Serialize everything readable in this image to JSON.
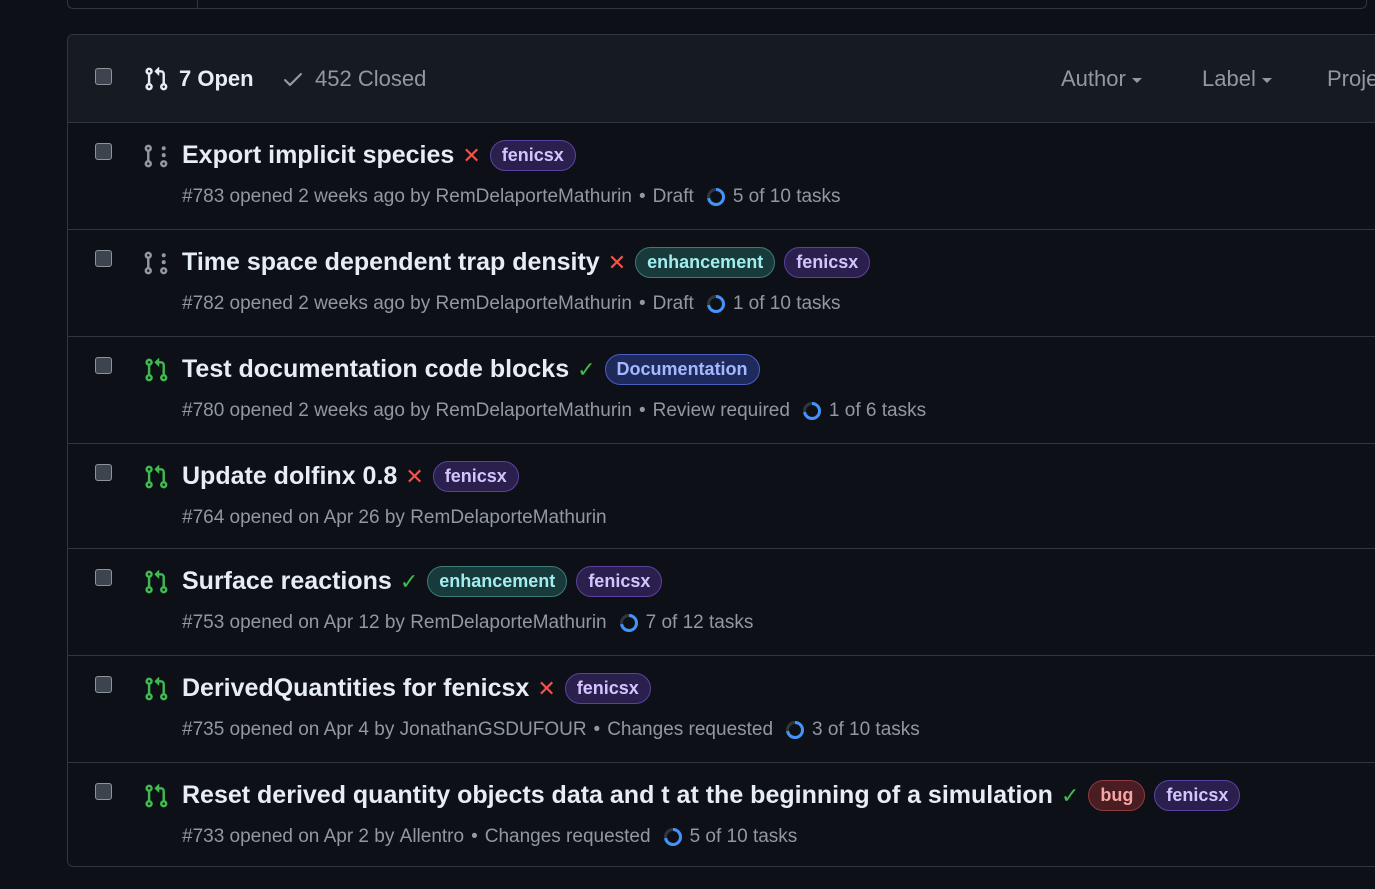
{
  "header": {
    "open_count_label": "7 Open",
    "closed_count_label": "452 Closed",
    "filters": [
      "Author",
      "Label",
      "Proje"
    ]
  },
  "colors": {
    "open_icon": "#3fb950",
    "draft_icon": "#9198a1",
    "check_fail": "#f85149",
    "check_ok": "#3fb950",
    "progress": "#4493f8"
  },
  "labels": {
    "fenicsx": {
      "text": "fenicsx",
      "bg": "#2b1f4d",
      "fg": "#d3c4ff",
      "border": "#5a43a0"
    },
    "enhancement": {
      "text": "enhancement",
      "bg": "#193a3a",
      "fg": "#a2eeef",
      "border": "#3d7a78"
    },
    "documentation": {
      "text": "Documentation",
      "bg": "#1f2a5c",
      "fg": "#a5b8ff",
      "border": "#4a5fbf"
    },
    "bug": {
      "text": "bug",
      "bg": "#4a1d22",
      "fg": "#f6a4a4",
      "border": "#8e3a40"
    }
  },
  "pull_requests": [
    {
      "state": "draft",
      "title": "Export implicit species",
      "check": "fail",
      "labels": [
        "fenicsx"
      ],
      "number_opened": "#783 opened 2 weeks ago by",
      "author": "RemDelaporteMathurin",
      "review": "Draft",
      "tasks": "5 of 10 tasks",
      "tasks_done": 5,
      "tasks_total": 10
    },
    {
      "state": "draft",
      "title": "Time space dependent trap density",
      "check": "fail",
      "labels": [
        "enhancement",
        "fenicsx"
      ],
      "number_opened": "#782 opened 2 weeks ago by",
      "author": "RemDelaporteMathurin",
      "review": "Draft",
      "tasks": "1 of 10 tasks",
      "tasks_done": 1,
      "tasks_total": 10
    },
    {
      "state": "open",
      "title": "Test documentation code blocks",
      "check": "ok",
      "labels": [
        "documentation"
      ],
      "number_opened": "#780 opened 2 weeks ago by",
      "author": "RemDelaporteMathurin",
      "review": "Review required",
      "tasks": "1 of 6 tasks",
      "tasks_done": 1,
      "tasks_total": 6
    },
    {
      "state": "open",
      "title": "Update dolfinx 0.8",
      "check": "fail",
      "labels": [
        "fenicsx"
      ],
      "number_opened": "#764 opened on Apr 26 by",
      "author": "RemDelaporteMathurin",
      "review": "",
      "tasks": "",
      "tasks_done": 0,
      "tasks_total": 0
    },
    {
      "state": "open",
      "title": "Surface reactions",
      "check": "ok",
      "labels": [
        "enhancement",
        "fenicsx"
      ],
      "number_opened": "#753 opened on Apr 12 by",
      "author": "RemDelaporteMathurin",
      "review": "",
      "tasks": "7 of 12 tasks",
      "tasks_done": 7,
      "tasks_total": 12
    },
    {
      "state": "open",
      "title": "DerivedQuantities for fenicsx",
      "check": "fail",
      "labels": [
        "fenicsx"
      ],
      "number_opened": "#735 opened on Apr 4 by",
      "author": "JonathanGSDUFOUR",
      "review": "Changes requested",
      "tasks": "3 of 10 tasks",
      "tasks_done": 3,
      "tasks_total": 10
    },
    {
      "state": "open",
      "title": "Reset derived quantity objects data and t at the beginning of a simulation",
      "check": "ok",
      "labels": [
        "bug",
        "fenicsx"
      ],
      "number_opened": "#733 opened on Apr 2 by",
      "author": "Allentro",
      "review": "Changes requested",
      "tasks": "5 of 10 tasks",
      "tasks_done": 5,
      "tasks_total": 10
    }
  ]
}
